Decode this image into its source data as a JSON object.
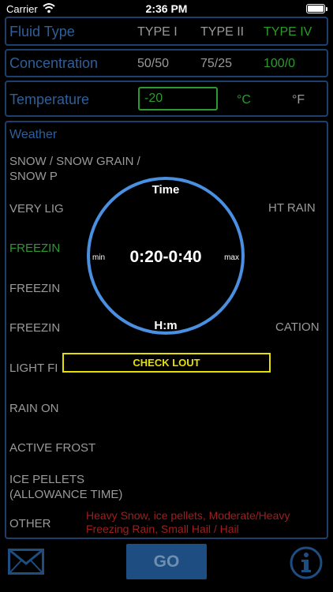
{
  "status_bar": {
    "carrier": "Carrier",
    "time": "2:36 PM"
  },
  "fluid_type": {
    "label": "Fluid Type",
    "options": [
      "TYPE I",
      "TYPE II",
      "TYPE IV"
    ],
    "selected": "TYPE IV"
  },
  "concentration": {
    "label": "Concentration",
    "options": [
      "50/50",
      "75/25",
      "100/0"
    ],
    "selected": "100/0"
  },
  "temperature": {
    "label": "Temperature",
    "value": "-20",
    "unit_c": "°C",
    "unit_f": "°F",
    "selected_unit": "°C"
  },
  "weather": {
    "title": "Weather",
    "items": [
      {
        "line1": "SNOW / SNOW GRAIN /",
        "line2": "SNOW P"
      },
      {
        "line1": "VERY LIG",
        "right": "HT RAIN"
      },
      {
        "line1": "FREEZIN",
        "selected": true
      },
      {
        "line1": "FREEZIN"
      },
      {
        "line1": "FREEZIN",
        "right": "CATION"
      },
      {
        "line1": "LIGHT FI"
      },
      {
        "line1": "RAIN ON"
      },
      {
        "line1": "ACTIVE FROST"
      },
      {
        "line1": "ICE PELLETS",
        "line2": "(ALLOWANCE TIME)"
      },
      {
        "line1": "OTHER"
      }
    ],
    "note": "Heavy Snow, ice pellets, Moderate/Heavy Freezing Rain, Small Hail / Hail"
  },
  "timer": {
    "top": "Time",
    "value": "0:20-0:40",
    "min": "min",
    "max": "max",
    "bottom": "H:m"
  },
  "check_button": "CHECK LOUT",
  "go_button": "GO",
  "icons": {
    "mail": "mail-icon",
    "info": "info-icon"
  },
  "colors": {
    "accent": "#4a90e2",
    "selected": "#2e9a2e",
    "warning": "#e6e000",
    "note": "#a01e1e",
    "label": "#2f5f99"
  }
}
